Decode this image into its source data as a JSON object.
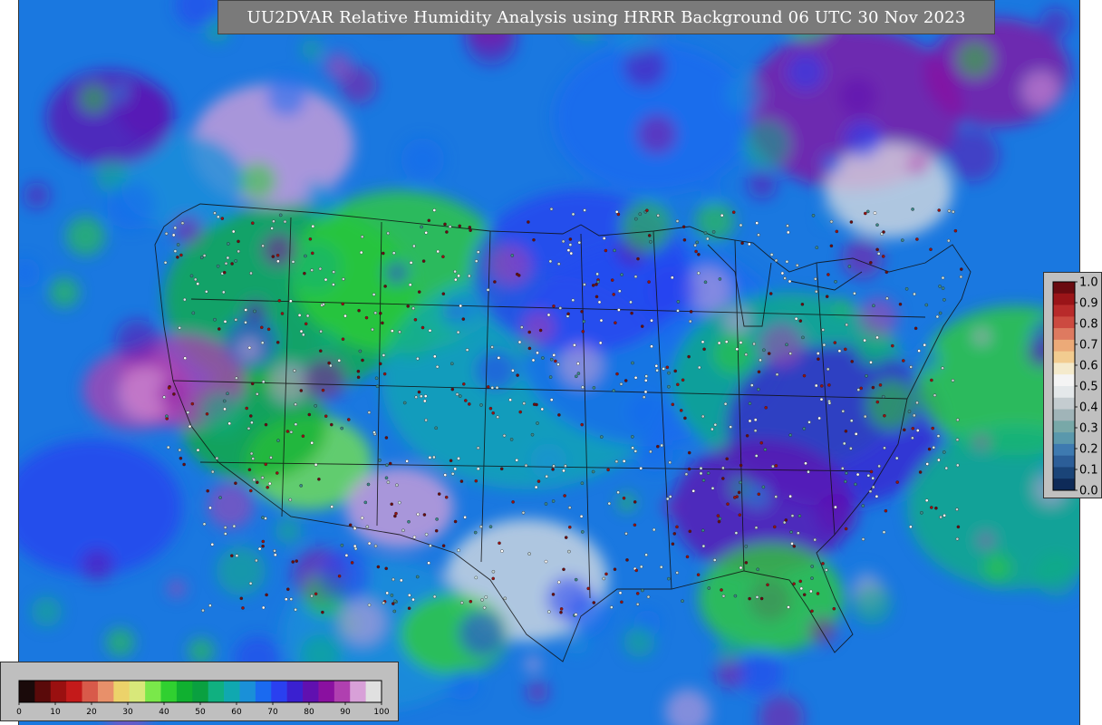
{
  "title": "UU2DVAR Relative Humidity Analysis using HRRR Background 06 UTC 30 Nov 2023",
  "rh_colorbar": {
    "ticks": [
      "0",
      "10",
      "20",
      "30",
      "40",
      "50",
      "60",
      "70",
      "80",
      "90",
      "100"
    ],
    "colors": [
      "#1a0a0a",
      "#5a0a0a",
      "#9a1010",
      "#c41a1a",
      "#d85a4a",
      "#e8906a",
      "#ecd26a",
      "#d8e87a",
      "#7ae84a",
      "#30d030",
      "#10b030",
      "#0aa040",
      "#10b080",
      "#10a8b0",
      "#1a90d8",
      "#1a6af0",
      "#2a40f0",
      "#3a20d0",
      "#6010b0",
      "#8a10a0",
      "#b040b0",
      "#d8a0d8",
      "#e0e0e0"
    ]
  },
  "residual_colorbar": {
    "ticks": [
      "1.0",
      "0.9",
      "0.8",
      "0.7",
      "0.6",
      "0.5",
      "0.4",
      "0.3",
      "0.2",
      "0.1",
      "0.0"
    ],
    "colors": [
      "#6a0a10",
      "#9a1418",
      "#b82a2a",
      "#cc4a40",
      "#de7a60",
      "#ecaa78",
      "#f2cc90",
      "#f4eacc",
      "#f4f4f4",
      "#e4e8ea",
      "#c4ccd0",
      "#a0b4b8",
      "#78a8a8",
      "#5a98ac",
      "#3e7ab0",
      "#2c5e98",
      "#1a4478",
      "#0e2a58"
    ]
  },
  "map": {
    "ocean_colors": [
      "#1a6af0",
      "#1a90d8",
      "#2a40f0",
      "#6010b0",
      "#8a10a0",
      "#b040b0",
      "#d8a0d8",
      "#10b080",
      "#30d030"
    ]
  }
}
